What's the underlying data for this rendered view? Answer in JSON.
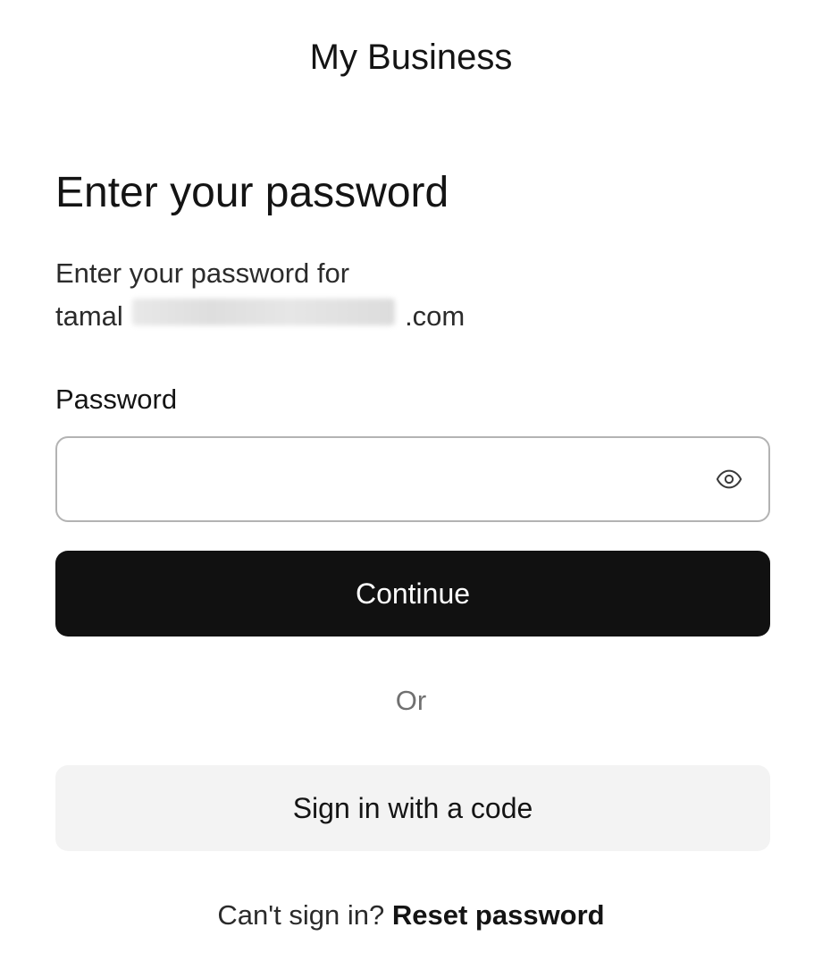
{
  "brand": {
    "name": "My Business"
  },
  "heading": {
    "title": "Enter your password"
  },
  "subtitle": {
    "line1": "Enter your password for",
    "email_prefix": "tamal",
    "email_suffix": ".com"
  },
  "password_field": {
    "label": "Password",
    "value": "",
    "placeholder": "",
    "toggle_icon": "eye-icon"
  },
  "actions": {
    "continue_label": "Continue",
    "divider_text": "Or",
    "code_signin_label": "Sign in with a code"
  },
  "footer": {
    "prompt": "Can't sign in?",
    "reset_link": "Reset password"
  },
  "colors": {
    "primary_button_bg": "#111111",
    "secondary_button_bg": "#f3f3f3",
    "input_border": "#b3b3b3",
    "muted_text": "#707070"
  }
}
